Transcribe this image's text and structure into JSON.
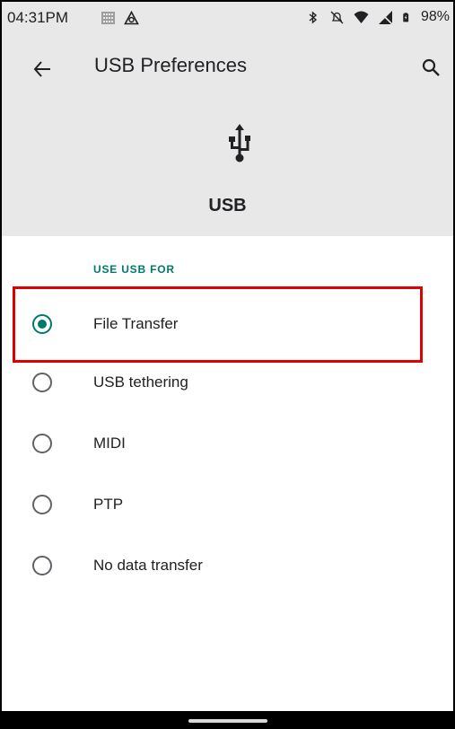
{
  "status_bar": {
    "time": "04:31PM",
    "battery": "98%",
    "icons": [
      "sim-card-icon",
      "vpn-icon",
      "bluetooth-icon",
      "notifications-off-icon",
      "wifi-icon",
      "cellular-icon",
      "battery-icon"
    ]
  },
  "app_bar": {
    "title": "USB Preferences",
    "back_icon": "arrow-back-icon",
    "search_icon": "search-icon"
  },
  "header": {
    "icon": "usb-icon",
    "label": "USB"
  },
  "section": {
    "title": "USE USB FOR"
  },
  "options": [
    {
      "label": "File Transfer",
      "selected": true
    },
    {
      "label": "USB tethering",
      "selected": false
    },
    {
      "label": "MIDI",
      "selected": false
    },
    {
      "label": "PTP",
      "selected": false
    },
    {
      "label": "No data transfer",
      "selected": false
    }
  ],
  "colors": {
    "accent": "#00796b",
    "highlight": "#e00000",
    "header_bg": "#e8e8e8"
  }
}
